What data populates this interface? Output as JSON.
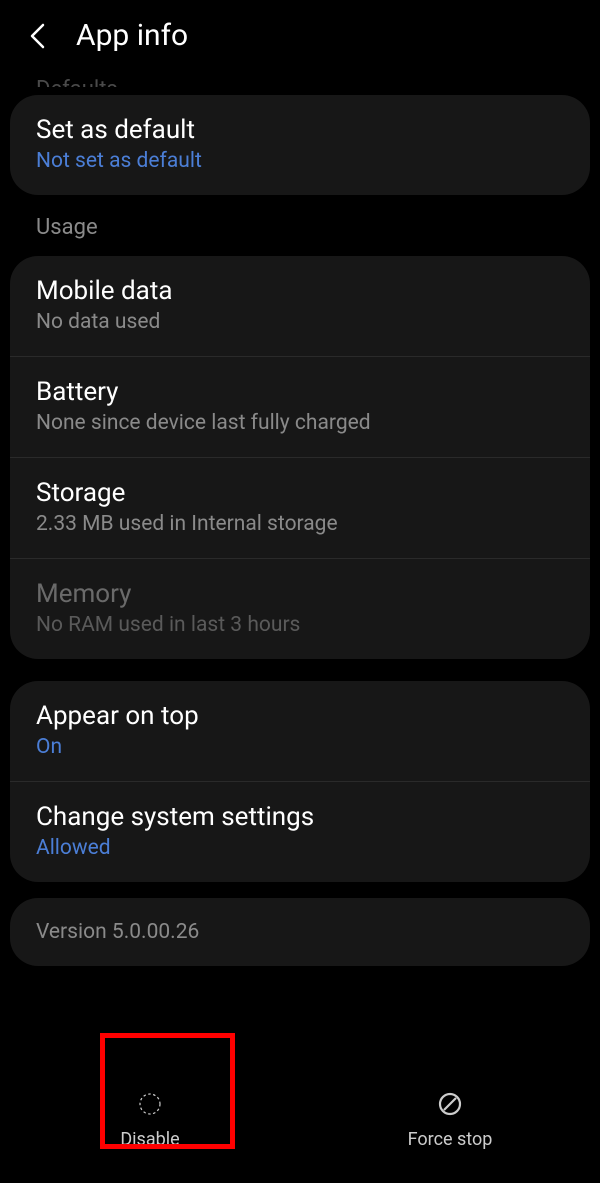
{
  "header": {
    "title": "App info"
  },
  "cutoffSection": "Defaults",
  "setDefault": {
    "title": "Set as default",
    "subtitle": "Not set as default"
  },
  "usageHeader": "Usage",
  "mobileData": {
    "title": "Mobile data",
    "subtitle": "No data used"
  },
  "battery": {
    "title": "Battery",
    "subtitle": "None since device last fully charged"
  },
  "storage": {
    "title": "Storage",
    "subtitle": "2.33 MB used in Internal storage"
  },
  "memory": {
    "title": "Memory",
    "subtitle": "No RAM used in last 3 hours"
  },
  "appearOnTop": {
    "title": "Appear on top",
    "subtitle": "On"
  },
  "changeSystem": {
    "title": "Change system settings",
    "subtitle": "Allowed"
  },
  "version": "Version 5.0.00.26",
  "bottomBar": {
    "disable": "Disable",
    "forceStop": "Force stop"
  }
}
